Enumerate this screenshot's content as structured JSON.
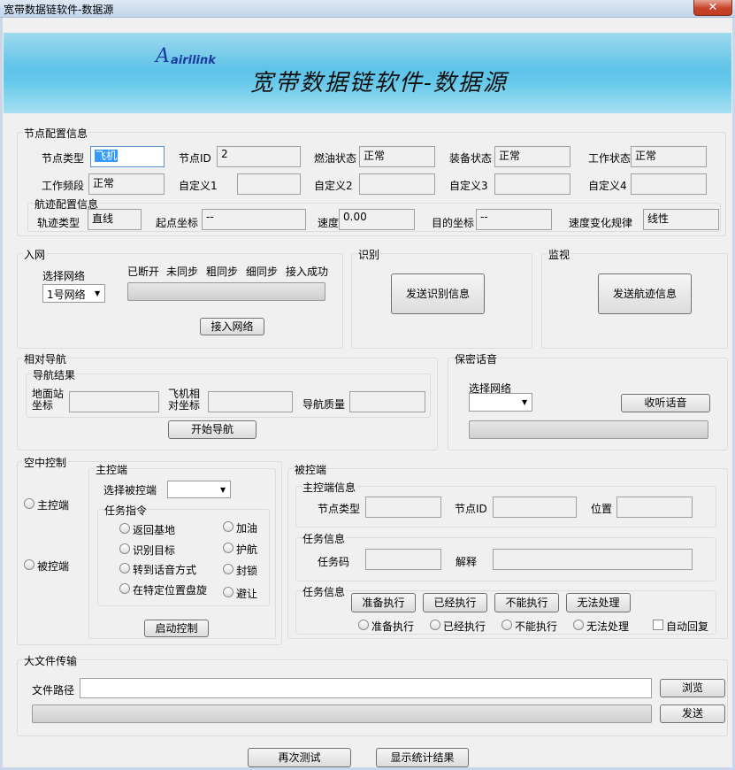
{
  "window": {
    "title": "宽带数据链软件-数据源",
    "close_glyph": "✕"
  },
  "banner": {
    "logo_mark": "A",
    "logo_text": "airilink",
    "title": "宽带数据链软件-数据源"
  },
  "node_config": {
    "group_title": "节点配置信息",
    "node_type_label": "节点类型",
    "node_type_value": "飞机",
    "node_id_label": "节点ID",
    "node_id_value": "2",
    "fuel_label": "燃油状态",
    "fuel_value": "正常",
    "equip_label": "装备状态",
    "equip_value": "正常",
    "work_label": "工作状态",
    "work_value": "正常",
    "freq_label": "工作频段",
    "freq_value": "正常",
    "custom1_label": "自定义1",
    "custom2_label": "自定义2",
    "custom3_label": "自定义3",
    "custom4_label": "自定义4",
    "track": {
      "group_title": "航迹配置信息",
      "type_label": "轨迹类型",
      "type_value": "直线",
      "start_label": "起点坐标",
      "start_value": "--",
      "speed_label": "速度",
      "speed_value": "0.00",
      "dest_label": "目的坐标",
      "dest_value": "--",
      "rule_label": "速度变化规律",
      "rule_value": "线性"
    }
  },
  "network_entry": {
    "group_title": "入网",
    "select_label": "选择网络",
    "select_value": "1号网络",
    "stages": [
      "已断开",
      "未同步",
      "粗同步",
      "细同步",
      "接入成功"
    ],
    "join_button": "接入网络"
  },
  "identify": {
    "group_title": "识别",
    "send_button": "发送识别信息"
  },
  "monitor": {
    "group_title": "监视",
    "send_button": "发送航迹信息"
  },
  "relative_nav": {
    "group_title": "相对导航",
    "result_title": "导航结果",
    "ground_label": "地面站坐标",
    "plane_label": "飞机相对坐标",
    "quality_label": "导航质量",
    "start_button": "开始导航"
  },
  "secure_voice": {
    "group_title": "保密话音",
    "select_label": "选择网络",
    "listen_button": "收听话音"
  },
  "air_control": {
    "group_title": "空中控制",
    "master_radio": "主控端",
    "slave_radio": "被控端",
    "master": {
      "group_title": "主控端",
      "select_label": "选择被控端",
      "task_title": "任务指令",
      "tasks": [
        "返回基地",
        "识别目标",
        "转到话音方式",
        "在特定位置盘旋",
        "加油",
        "护航",
        "封锁",
        "避让"
      ],
      "start_button": "启动控制"
    },
    "slave": {
      "group_title": "被控端",
      "master_info_title": "主控端信息",
      "node_type_label": "节点类型",
      "node_id_label": "节点ID",
      "position_label": "位置",
      "task_info_title": "任务信息",
      "task_code_label": "任务码",
      "explain_label": "解释",
      "task_info2_title": "任务信息",
      "buttons": [
        "准备执行",
        "已经执行",
        "不能执行",
        "无法处理"
      ],
      "radios": [
        "准备执行",
        "已经执行",
        "不能执行",
        "无法处理"
      ],
      "auto_reply": "自动回复"
    }
  },
  "file_transfer": {
    "group_title": "大文件传输",
    "path_label": "文件路径",
    "browse_button": "浏览",
    "send_button": "发送"
  },
  "bottom": {
    "retest_button": "再次测试",
    "stats_button": "显示统计结果"
  }
}
